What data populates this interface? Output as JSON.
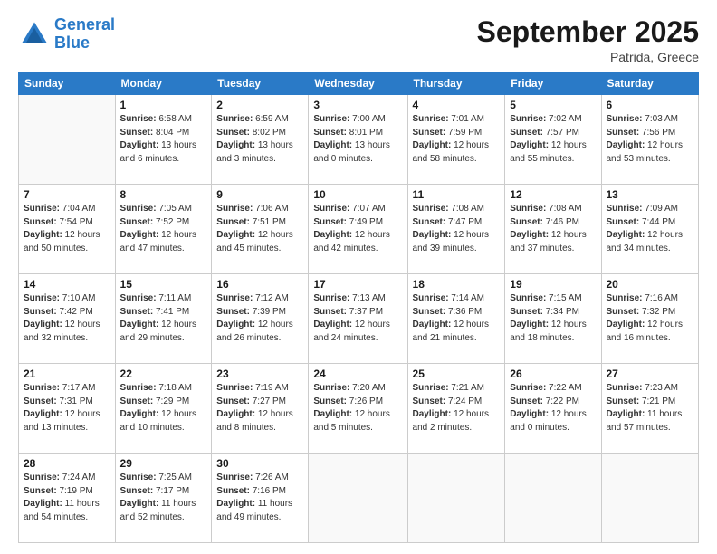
{
  "logo": {
    "line1": "General",
    "line2": "Blue"
  },
  "header": {
    "month": "September 2025",
    "location": "Patrida, Greece"
  },
  "days_of_week": [
    "Sunday",
    "Monday",
    "Tuesday",
    "Wednesday",
    "Thursday",
    "Friday",
    "Saturday"
  ],
  "weeks": [
    [
      {
        "num": "",
        "sunrise": "",
        "sunset": "",
        "daylight": ""
      },
      {
        "num": "1",
        "sunrise": "Sunrise: 6:58 AM",
        "sunset": "Sunset: 8:04 PM",
        "daylight": "Daylight: 13 hours and 6 minutes."
      },
      {
        "num": "2",
        "sunrise": "Sunrise: 6:59 AM",
        "sunset": "Sunset: 8:02 PM",
        "daylight": "Daylight: 13 hours and 3 minutes."
      },
      {
        "num": "3",
        "sunrise": "Sunrise: 7:00 AM",
        "sunset": "Sunset: 8:01 PM",
        "daylight": "Daylight: 13 hours and 0 minutes."
      },
      {
        "num": "4",
        "sunrise": "Sunrise: 7:01 AM",
        "sunset": "Sunset: 7:59 PM",
        "daylight": "Daylight: 12 hours and 58 minutes."
      },
      {
        "num": "5",
        "sunrise": "Sunrise: 7:02 AM",
        "sunset": "Sunset: 7:57 PM",
        "daylight": "Daylight: 12 hours and 55 minutes."
      },
      {
        "num": "6",
        "sunrise": "Sunrise: 7:03 AM",
        "sunset": "Sunset: 7:56 PM",
        "daylight": "Daylight: 12 hours and 53 minutes."
      }
    ],
    [
      {
        "num": "7",
        "sunrise": "Sunrise: 7:04 AM",
        "sunset": "Sunset: 7:54 PM",
        "daylight": "Daylight: 12 hours and 50 minutes."
      },
      {
        "num": "8",
        "sunrise": "Sunrise: 7:05 AM",
        "sunset": "Sunset: 7:52 PM",
        "daylight": "Daylight: 12 hours and 47 minutes."
      },
      {
        "num": "9",
        "sunrise": "Sunrise: 7:06 AM",
        "sunset": "Sunset: 7:51 PM",
        "daylight": "Daylight: 12 hours and 45 minutes."
      },
      {
        "num": "10",
        "sunrise": "Sunrise: 7:07 AM",
        "sunset": "Sunset: 7:49 PM",
        "daylight": "Daylight: 12 hours and 42 minutes."
      },
      {
        "num": "11",
        "sunrise": "Sunrise: 7:08 AM",
        "sunset": "Sunset: 7:47 PM",
        "daylight": "Daylight: 12 hours and 39 minutes."
      },
      {
        "num": "12",
        "sunrise": "Sunrise: 7:08 AM",
        "sunset": "Sunset: 7:46 PM",
        "daylight": "Daylight: 12 hours and 37 minutes."
      },
      {
        "num": "13",
        "sunrise": "Sunrise: 7:09 AM",
        "sunset": "Sunset: 7:44 PM",
        "daylight": "Daylight: 12 hours and 34 minutes."
      }
    ],
    [
      {
        "num": "14",
        "sunrise": "Sunrise: 7:10 AM",
        "sunset": "Sunset: 7:42 PM",
        "daylight": "Daylight: 12 hours and 32 minutes."
      },
      {
        "num": "15",
        "sunrise": "Sunrise: 7:11 AM",
        "sunset": "Sunset: 7:41 PM",
        "daylight": "Daylight: 12 hours and 29 minutes."
      },
      {
        "num": "16",
        "sunrise": "Sunrise: 7:12 AM",
        "sunset": "Sunset: 7:39 PM",
        "daylight": "Daylight: 12 hours and 26 minutes."
      },
      {
        "num": "17",
        "sunrise": "Sunrise: 7:13 AM",
        "sunset": "Sunset: 7:37 PM",
        "daylight": "Daylight: 12 hours and 24 minutes."
      },
      {
        "num": "18",
        "sunrise": "Sunrise: 7:14 AM",
        "sunset": "Sunset: 7:36 PM",
        "daylight": "Daylight: 12 hours and 21 minutes."
      },
      {
        "num": "19",
        "sunrise": "Sunrise: 7:15 AM",
        "sunset": "Sunset: 7:34 PM",
        "daylight": "Daylight: 12 hours and 18 minutes."
      },
      {
        "num": "20",
        "sunrise": "Sunrise: 7:16 AM",
        "sunset": "Sunset: 7:32 PM",
        "daylight": "Daylight: 12 hours and 16 minutes."
      }
    ],
    [
      {
        "num": "21",
        "sunrise": "Sunrise: 7:17 AM",
        "sunset": "Sunset: 7:31 PM",
        "daylight": "Daylight: 12 hours and 13 minutes."
      },
      {
        "num": "22",
        "sunrise": "Sunrise: 7:18 AM",
        "sunset": "Sunset: 7:29 PM",
        "daylight": "Daylight: 12 hours and 10 minutes."
      },
      {
        "num": "23",
        "sunrise": "Sunrise: 7:19 AM",
        "sunset": "Sunset: 7:27 PM",
        "daylight": "Daylight: 12 hours and 8 minutes."
      },
      {
        "num": "24",
        "sunrise": "Sunrise: 7:20 AM",
        "sunset": "Sunset: 7:26 PM",
        "daylight": "Daylight: 12 hours and 5 minutes."
      },
      {
        "num": "25",
        "sunrise": "Sunrise: 7:21 AM",
        "sunset": "Sunset: 7:24 PM",
        "daylight": "Daylight: 12 hours and 2 minutes."
      },
      {
        "num": "26",
        "sunrise": "Sunrise: 7:22 AM",
        "sunset": "Sunset: 7:22 PM",
        "daylight": "Daylight: 12 hours and 0 minutes."
      },
      {
        "num": "27",
        "sunrise": "Sunrise: 7:23 AM",
        "sunset": "Sunset: 7:21 PM",
        "daylight": "Daylight: 11 hours and 57 minutes."
      }
    ],
    [
      {
        "num": "28",
        "sunrise": "Sunrise: 7:24 AM",
        "sunset": "Sunset: 7:19 PM",
        "daylight": "Daylight: 11 hours and 54 minutes."
      },
      {
        "num": "29",
        "sunrise": "Sunrise: 7:25 AM",
        "sunset": "Sunset: 7:17 PM",
        "daylight": "Daylight: 11 hours and 52 minutes."
      },
      {
        "num": "30",
        "sunrise": "Sunrise: 7:26 AM",
        "sunset": "Sunset: 7:16 PM",
        "daylight": "Daylight: 11 hours and 49 minutes."
      },
      {
        "num": "",
        "sunrise": "",
        "sunset": "",
        "daylight": ""
      },
      {
        "num": "",
        "sunrise": "",
        "sunset": "",
        "daylight": ""
      },
      {
        "num": "",
        "sunrise": "",
        "sunset": "",
        "daylight": ""
      },
      {
        "num": "",
        "sunrise": "",
        "sunset": "",
        "daylight": ""
      }
    ]
  ]
}
